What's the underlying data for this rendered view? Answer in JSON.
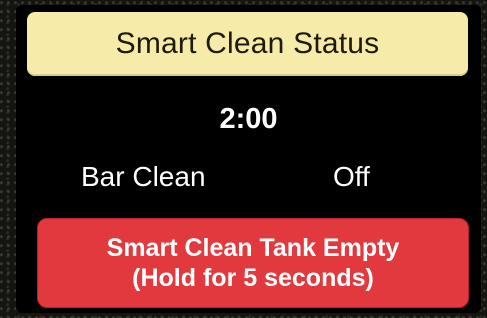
{
  "header": {
    "title": "Smart Clean Status"
  },
  "timer": {
    "value": "2:00"
  },
  "bar_clean": {
    "label": "Bar Clean",
    "value": "Off"
  },
  "alert_button": {
    "line1": "Smart Clean Tank Empty",
    "line2": "(Hold for 5 seconds)"
  },
  "colors": {
    "header_bg": "#f6eba8",
    "screen_bg": "#000000",
    "alert_bg": "#e2393f",
    "text": "#ffffff"
  }
}
